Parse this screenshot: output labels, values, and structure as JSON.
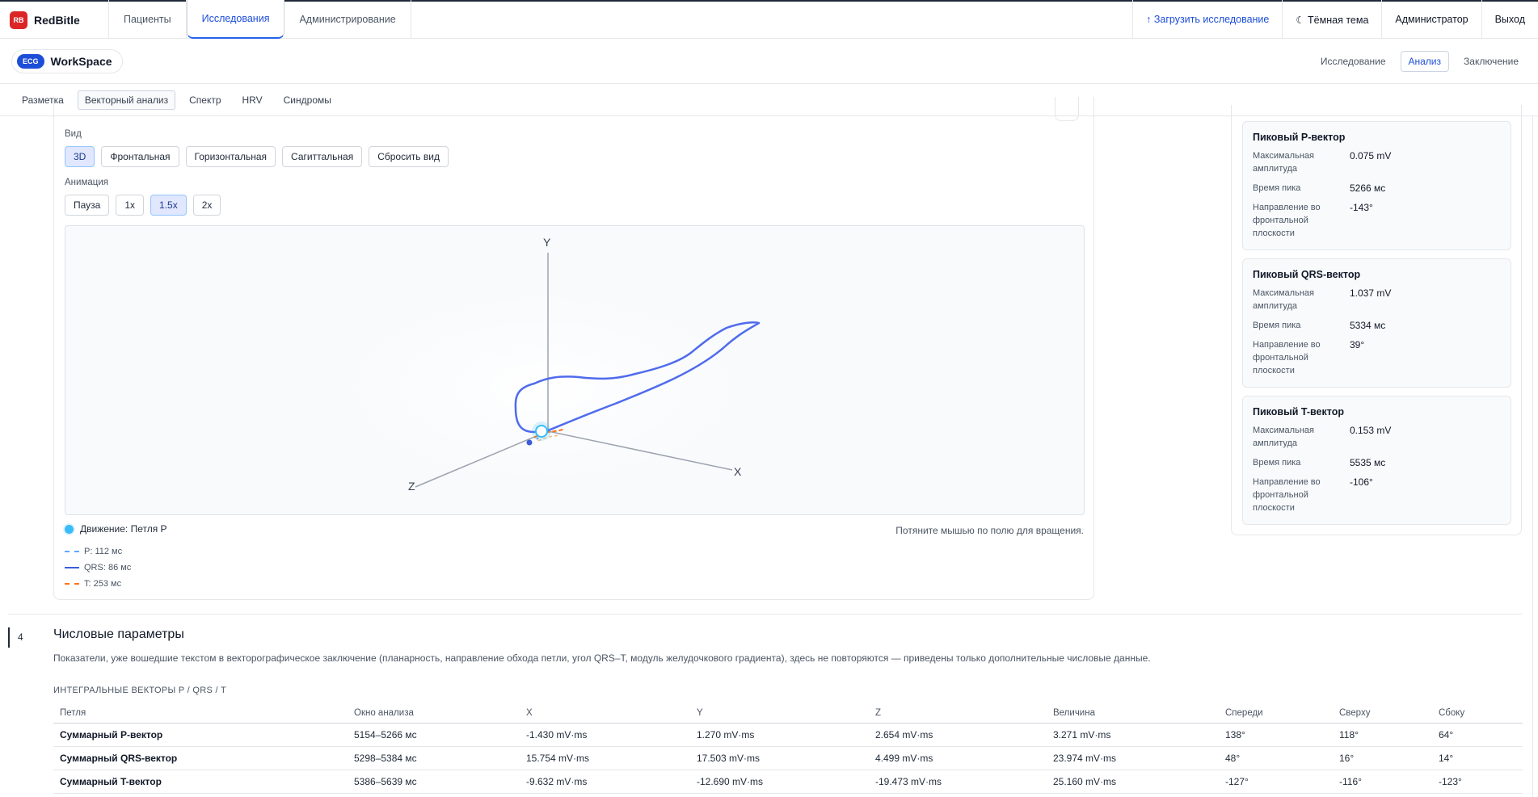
{
  "app": {
    "logo": "RB",
    "name": "RedBitle"
  },
  "nav": {
    "tabs": [
      "Пациенты",
      "Исследования",
      "Администрирование"
    ],
    "active": 1
  },
  "top_actions": {
    "upload": "↑ Загрузить исследование",
    "theme": "☾ Тёмная тема",
    "user": "Администратор",
    "logout": "Выход"
  },
  "workspace": {
    "badge": "ECG",
    "title": "WorkSpace",
    "tabs": [
      "Исследование",
      "Анализ",
      "Заключение"
    ],
    "active": 1
  },
  "subtabs": {
    "items": [
      "Разметка",
      "Векторный анализ",
      "Спектр",
      "HRV",
      "Синдромы"
    ],
    "active": 1
  },
  "vector_panel": {
    "view_label": "Вид",
    "view_buttons": [
      "3D",
      "Фронтальная",
      "Горизонтальная",
      "Сагиттальная",
      "Сбросить вид"
    ],
    "view_active": 0,
    "animation_label": "Анимация",
    "animation_buttons": [
      "Пауза",
      "1x",
      "1.5x",
      "2x"
    ],
    "animation_active": 2,
    "axes": {
      "x": "X",
      "y": "Y",
      "z": "Z"
    },
    "movement": "Движение: Петля P",
    "hint": "Потяните мышью по полю для вращения.",
    "legend": [
      {
        "label": "P: 112 мс",
        "color": "#60a5fa",
        "style": "dashed"
      },
      {
        "label": "QRS: 86 мс",
        "color": "#3b5bdb",
        "style": "solid"
      },
      {
        "label": "T: 253 мс",
        "color": "#f97316",
        "style": "dashed"
      }
    ]
  },
  "peak_vectors": [
    {
      "title": "Пиковый P-вектор",
      "amp_label": "Максимальная амплитуда",
      "amp": "0.075 mV",
      "time_label": "Время пика",
      "time": "5266 мс",
      "dir_label": "Направление во фронтальной плоскости",
      "dir": "-143°"
    },
    {
      "title": "Пиковый QRS-вектор",
      "amp_label": "Максимальная амплитуда",
      "amp": "1.037 mV",
      "time_label": "Время пика",
      "time": "5334 мс",
      "dir_label": "Направление во фронтальной плоскости",
      "dir": "39°"
    },
    {
      "title": "Пиковый T-вектор",
      "amp_label": "Максимальная амплитуда",
      "amp": "0.153 mV",
      "time_label": "Время пика",
      "time": "5535 мс",
      "dir_label": "Направление во фронтальной плоскости",
      "dir": "-106°"
    }
  ],
  "section4": {
    "number": "4",
    "title": "Числовые параметры",
    "description": "Показатели, уже вошедшие текстом в векторографическое заключение (планарность, направление обхода петли, угол QRS–T, модуль желудочкового градиента), здесь не повторяются — приведены только дополнительные числовые данные.",
    "table_caption": "ИНТЕГРАЛЬНЫЕ ВЕКТОРЫ P / QRS / T",
    "columns": [
      "Петля",
      "Окно анализа",
      "X",
      "Y",
      "Z",
      "Величина",
      "Спереди",
      "Сверху",
      "Сбоку"
    ],
    "rows": [
      [
        "Суммарный P-вектор",
        "5154–5266 мс",
        "-1.430 mV·ms",
        "1.270 mV·ms",
        "2.654 mV·ms",
        "3.271 mV·ms",
        "138°",
        "118°",
        "64°"
      ],
      [
        "Суммарный QRS-вектор",
        "5298–5384 мс",
        "15.754 mV·ms",
        "17.503 mV·ms",
        "4.499 mV·ms",
        "23.974 mV·ms",
        "48°",
        "16°",
        "14°"
      ],
      [
        "Суммарный T-вектор",
        "5386–5639 мс",
        "-9.632 mV·ms",
        "-12.690 mV·ms",
        "-19.473 mV·ms",
        "25.160 mV·ms",
        "-127°",
        "-116°",
        "-123°"
      ]
    ]
  }
}
